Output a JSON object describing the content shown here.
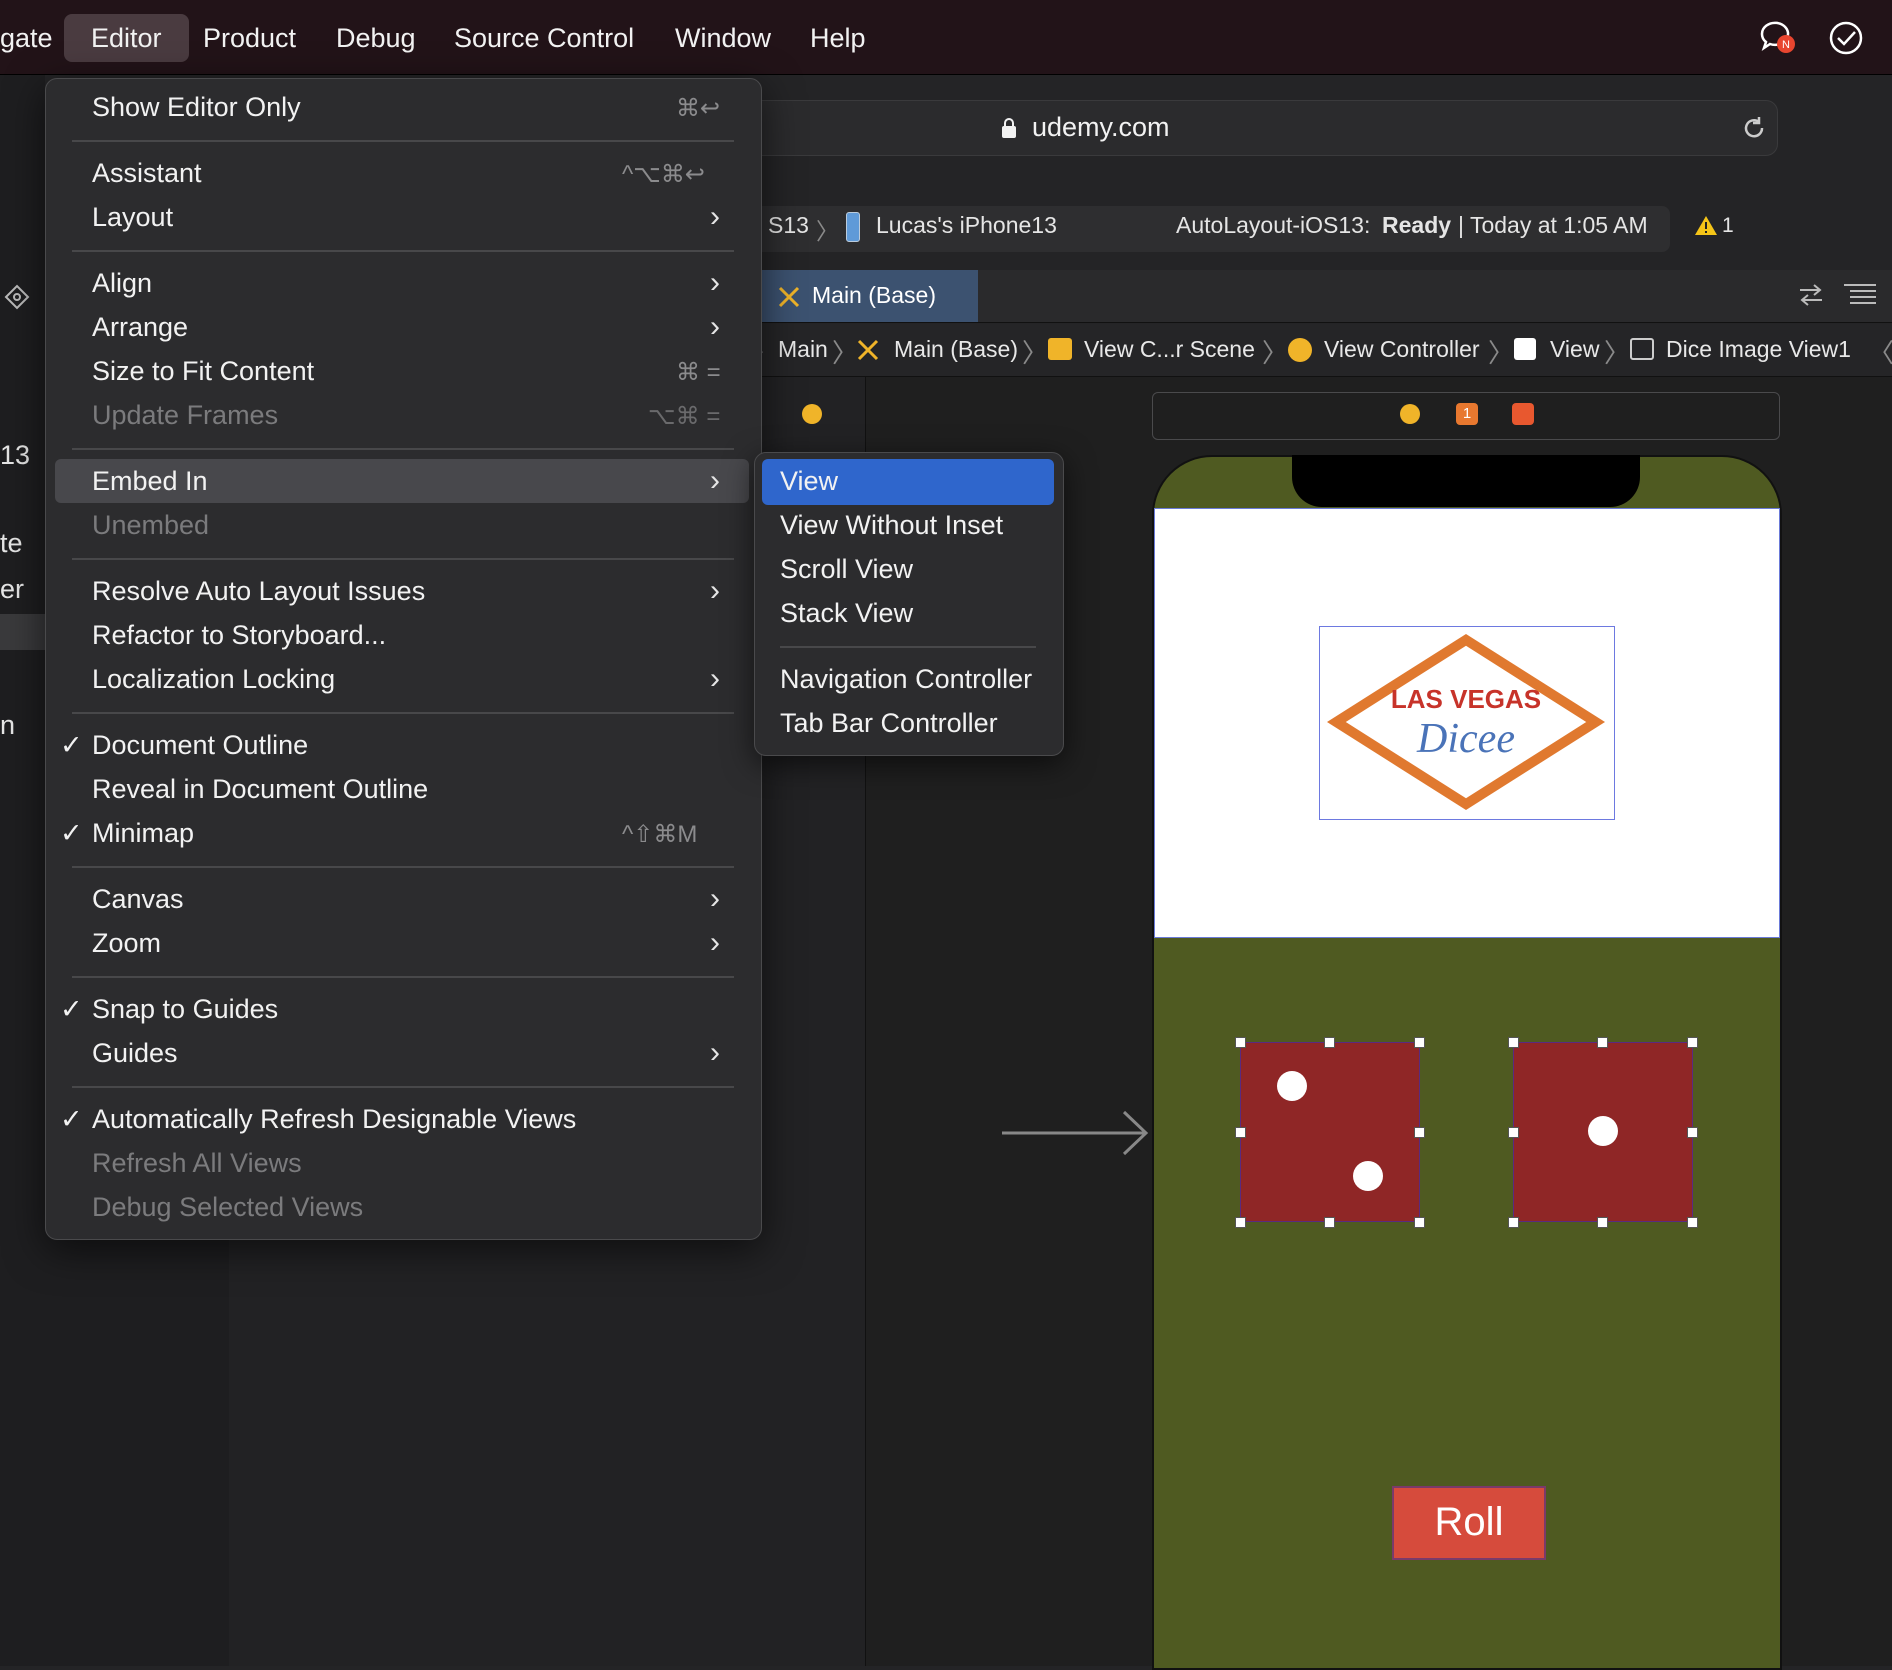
{
  "menubar": {
    "items": [
      "gate",
      "Editor",
      "Product",
      "Debug",
      "Source Control",
      "Window",
      "Help"
    ]
  },
  "browser": {
    "url": "udemy.com"
  },
  "status": {
    "scheme_fragment": "S13",
    "device": "Lucas's iPhone13",
    "project": "AutoLayout-iOS13:",
    "state": "Ready",
    "time": "| Today at 1:05 AM",
    "warning_count": "1"
  },
  "tab": {
    "label": "Main (Base)"
  },
  "breadcrumb": [
    "Main",
    "Main (Base)",
    "View C...r Scene",
    "View Controller",
    "View",
    "Dice Image View1"
  ],
  "sidebar_fragments": [
    "13",
    "te",
    "er",
    "n"
  ],
  "editor_menu": {
    "items": [
      {
        "label": "Show Editor Only",
        "shortcut": "⌘↩"
      },
      {
        "label": "Assistant",
        "shortcut": "^⌥⌘↩"
      },
      {
        "label": "Layout"
      },
      {
        "label": "Align"
      },
      {
        "label": "Arrange"
      },
      {
        "label": "Size to Fit Content",
        "shortcut": "⌘ ="
      },
      {
        "label": "Update Frames",
        "shortcut": "⌥⌘ ="
      },
      {
        "label": "Embed In"
      },
      {
        "label": "Unembed"
      },
      {
        "label": "Resolve Auto Layout Issues"
      },
      {
        "label": "Refactor to Storyboard..."
      },
      {
        "label": "Localization Locking"
      },
      {
        "label": "Document Outline"
      },
      {
        "label": "Reveal in Document Outline"
      },
      {
        "label": "Minimap",
        "shortcut": "^⇧⌘M"
      },
      {
        "label": "Canvas"
      },
      {
        "label": "Zoom"
      },
      {
        "label": "Snap to Guides"
      },
      {
        "label": "Guides"
      },
      {
        "label": "Automatically Refresh Designable Views"
      },
      {
        "label": "Refresh All Views"
      },
      {
        "label": "Debug Selected Views"
      }
    ]
  },
  "embed_submenu": {
    "items": [
      "View",
      "View Without Inset",
      "Scroll View",
      "Stack View",
      "Navigation Controller",
      "Tab Bar Controller"
    ]
  },
  "scene": {
    "logo_line1": "LAS VEGAS",
    "logo_line2": "Dicee",
    "roll_label": "Roll",
    "scene_badge": "1"
  },
  "colors": {
    "menubar_bg": "#221318",
    "menu_bg": "#2c2c2e",
    "selection_blue": "#2f66cc",
    "felt_green": "#4f5a21",
    "die_red": "#8f2626",
    "roll_red": "#d64b3c"
  }
}
